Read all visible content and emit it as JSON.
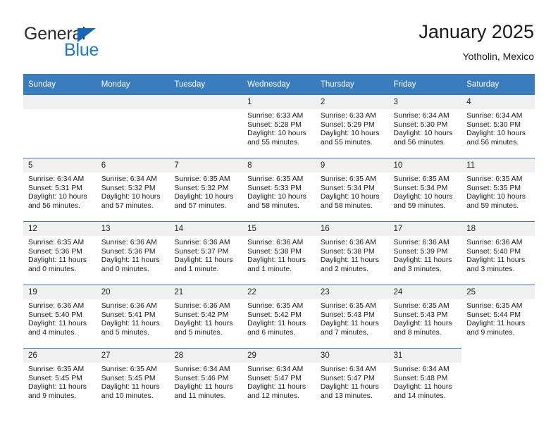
{
  "brand": {
    "name_top": "General",
    "name_bottom": "Blue",
    "triangle_color": "#1467b3",
    "blue_color": "#1d7ac4"
  },
  "header": {
    "title": "January 2025",
    "subtitle": "Yotholin, Mexico"
  },
  "theme": {
    "header_band": "#3a7dbf",
    "daynum_band": "#f0f0f0",
    "row_border": "#3a7dbf"
  },
  "weekday_headers": [
    "Sunday",
    "Monday",
    "Tuesday",
    "Wednesday",
    "Thursday",
    "Friday",
    "Saturday"
  ],
  "weeks": [
    [
      {
        "day": "",
        "blank": true
      },
      {
        "day": "",
        "blank": true
      },
      {
        "day": "",
        "blank": true
      },
      {
        "day": "1",
        "sunrise": "Sunrise: 6:33 AM",
        "sunset": "Sunset: 5:28 PM",
        "daylight": "Daylight: 10 hours and 55 minutes."
      },
      {
        "day": "2",
        "sunrise": "Sunrise: 6:33 AM",
        "sunset": "Sunset: 5:29 PM",
        "daylight": "Daylight: 10 hours and 55 minutes."
      },
      {
        "day": "3",
        "sunrise": "Sunrise: 6:34 AM",
        "sunset": "Sunset: 5:30 PM",
        "daylight": "Daylight: 10 hours and 56 minutes."
      },
      {
        "day": "4",
        "sunrise": "Sunrise: 6:34 AM",
        "sunset": "Sunset: 5:30 PM",
        "daylight": "Daylight: 10 hours and 56 minutes."
      }
    ],
    [
      {
        "day": "5",
        "sunrise": "Sunrise: 6:34 AM",
        "sunset": "Sunset: 5:31 PM",
        "daylight": "Daylight: 10 hours and 56 minutes."
      },
      {
        "day": "6",
        "sunrise": "Sunrise: 6:34 AM",
        "sunset": "Sunset: 5:32 PM",
        "daylight": "Daylight: 10 hours and 57 minutes."
      },
      {
        "day": "7",
        "sunrise": "Sunrise: 6:35 AM",
        "sunset": "Sunset: 5:32 PM",
        "daylight": "Daylight: 10 hours and 57 minutes."
      },
      {
        "day": "8",
        "sunrise": "Sunrise: 6:35 AM",
        "sunset": "Sunset: 5:33 PM",
        "daylight": "Daylight: 10 hours and 58 minutes."
      },
      {
        "day": "9",
        "sunrise": "Sunrise: 6:35 AM",
        "sunset": "Sunset: 5:34 PM",
        "daylight": "Daylight: 10 hours and 58 minutes."
      },
      {
        "day": "10",
        "sunrise": "Sunrise: 6:35 AM",
        "sunset": "Sunset: 5:34 PM",
        "daylight": "Daylight: 10 hours and 59 minutes."
      },
      {
        "day": "11",
        "sunrise": "Sunrise: 6:35 AM",
        "sunset": "Sunset: 5:35 PM",
        "daylight": "Daylight: 10 hours and 59 minutes."
      }
    ],
    [
      {
        "day": "12",
        "sunrise": "Sunrise: 6:35 AM",
        "sunset": "Sunset: 5:36 PM",
        "daylight": "Daylight: 11 hours and 0 minutes."
      },
      {
        "day": "13",
        "sunrise": "Sunrise: 6:36 AM",
        "sunset": "Sunset: 5:36 PM",
        "daylight": "Daylight: 11 hours and 0 minutes."
      },
      {
        "day": "14",
        "sunrise": "Sunrise: 6:36 AM",
        "sunset": "Sunset: 5:37 PM",
        "daylight": "Daylight: 11 hours and 1 minute."
      },
      {
        "day": "15",
        "sunrise": "Sunrise: 6:36 AM",
        "sunset": "Sunset: 5:38 PM",
        "daylight": "Daylight: 11 hours and 1 minute."
      },
      {
        "day": "16",
        "sunrise": "Sunrise: 6:36 AM",
        "sunset": "Sunset: 5:38 PM",
        "daylight": "Daylight: 11 hours and 2 minutes."
      },
      {
        "day": "17",
        "sunrise": "Sunrise: 6:36 AM",
        "sunset": "Sunset: 5:39 PM",
        "daylight": "Daylight: 11 hours and 3 minutes."
      },
      {
        "day": "18",
        "sunrise": "Sunrise: 6:36 AM",
        "sunset": "Sunset: 5:40 PM",
        "daylight": "Daylight: 11 hours and 3 minutes."
      }
    ],
    [
      {
        "day": "19",
        "sunrise": "Sunrise: 6:36 AM",
        "sunset": "Sunset: 5:40 PM",
        "daylight": "Daylight: 11 hours and 4 minutes."
      },
      {
        "day": "20",
        "sunrise": "Sunrise: 6:36 AM",
        "sunset": "Sunset: 5:41 PM",
        "daylight": "Daylight: 11 hours and 5 minutes."
      },
      {
        "day": "21",
        "sunrise": "Sunrise: 6:36 AM",
        "sunset": "Sunset: 5:42 PM",
        "daylight": "Daylight: 11 hours and 5 minutes."
      },
      {
        "day": "22",
        "sunrise": "Sunrise: 6:35 AM",
        "sunset": "Sunset: 5:42 PM",
        "daylight": "Daylight: 11 hours and 6 minutes."
      },
      {
        "day": "23",
        "sunrise": "Sunrise: 6:35 AM",
        "sunset": "Sunset: 5:43 PM",
        "daylight": "Daylight: 11 hours and 7 minutes."
      },
      {
        "day": "24",
        "sunrise": "Sunrise: 6:35 AM",
        "sunset": "Sunset: 5:43 PM",
        "daylight": "Daylight: 11 hours and 8 minutes."
      },
      {
        "day": "25",
        "sunrise": "Sunrise: 6:35 AM",
        "sunset": "Sunset: 5:44 PM",
        "daylight": "Daylight: 11 hours and 9 minutes."
      }
    ],
    [
      {
        "day": "26",
        "sunrise": "Sunrise: 6:35 AM",
        "sunset": "Sunset: 5:45 PM",
        "daylight": "Daylight: 11 hours and 9 minutes."
      },
      {
        "day": "27",
        "sunrise": "Sunrise: 6:35 AM",
        "sunset": "Sunset: 5:45 PM",
        "daylight": "Daylight: 11 hours and 10 minutes."
      },
      {
        "day": "28",
        "sunrise": "Sunrise: 6:34 AM",
        "sunset": "Sunset: 5:46 PM",
        "daylight": "Daylight: 11 hours and 11 minutes."
      },
      {
        "day": "29",
        "sunrise": "Sunrise: 6:34 AM",
        "sunset": "Sunset: 5:47 PM",
        "daylight": "Daylight: 11 hours and 12 minutes."
      },
      {
        "day": "30",
        "sunrise": "Sunrise: 6:34 AM",
        "sunset": "Sunset: 5:47 PM",
        "daylight": "Daylight: 11 hours and 13 minutes."
      },
      {
        "day": "31",
        "sunrise": "Sunrise: 6:34 AM",
        "sunset": "Sunset: 5:48 PM",
        "daylight": "Daylight: 11 hours and 14 minutes."
      },
      {
        "day": "",
        "blank": true,
        "tail": true
      }
    ]
  ]
}
